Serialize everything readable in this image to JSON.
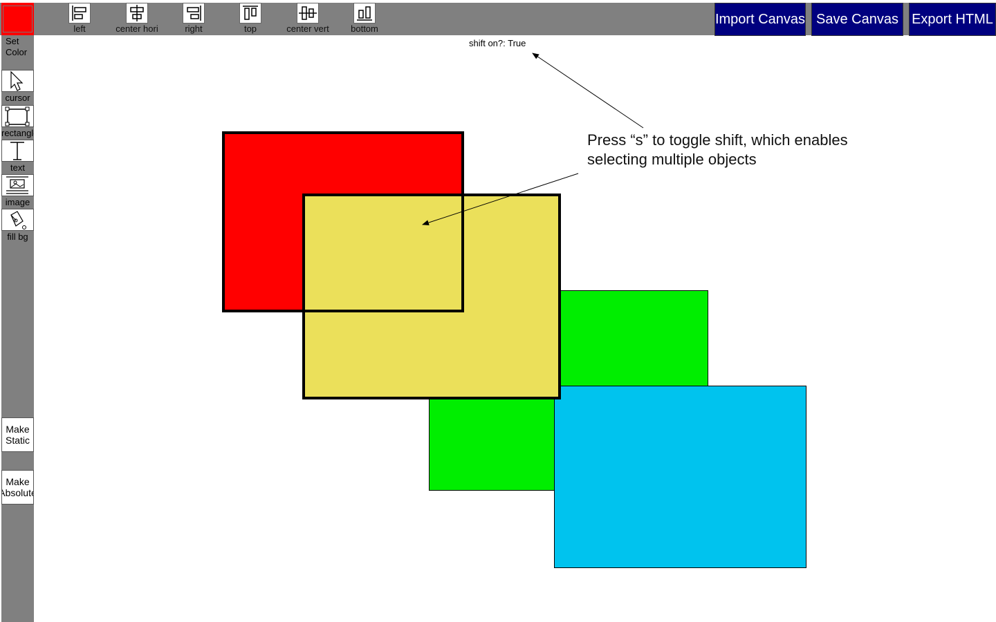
{
  "toolbar": {
    "color": {
      "value": "#ff0000",
      "label": "Set\nColor"
    },
    "align": [
      {
        "label": "left",
        "icon": "align-left-icon"
      },
      {
        "label": "center hori",
        "icon": "align-center-horizontal-icon"
      },
      {
        "label": "right",
        "icon": "align-right-icon"
      },
      {
        "label": "top",
        "icon": "align-top-icon"
      },
      {
        "label": "center vert",
        "icon": "align-center-vertical-icon"
      },
      {
        "label": "bottom",
        "icon": "align-bottom-icon"
      }
    ],
    "actions": {
      "import": "Import Canvas",
      "save": "Save Canvas",
      "export": "Export HTML"
    },
    "accent": "#00007f"
  },
  "sidebar": {
    "tools": [
      {
        "label": "cursor",
        "icon": "cursor-icon"
      },
      {
        "label": "rectangle",
        "icon": "rectangle-icon"
      },
      {
        "label": "text",
        "icon": "text-icon"
      },
      {
        "label": "image",
        "icon": "image-icon"
      },
      {
        "label": "fill bg",
        "icon": "fill-bucket-icon"
      }
    ],
    "buttons": {
      "make_static": "Make\nStatic",
      "make_absolute": "Make\nAbsolute"
    }
  },
  "canvas": {
    "shift_status": "shift on?: True",
    "shapes": [
      {
        "name": "red",
        "fill": "#ff0000",
        "selected": true
      },
      {
        "name": "yellow",
        "fill": "#ebe05a",
        "selected": true
      },
      {
        "name": "green",
        "fill": "#00ee00",
        "selected": false
      },
      {
        "name": "blue",
        "fill": "#00c3ee",
        "selected": false
      }
    ]
  },
  "annotation": {
    "text": "Press “s” to toggle shift, which enables\nselecting multiple objects"
  }
}
